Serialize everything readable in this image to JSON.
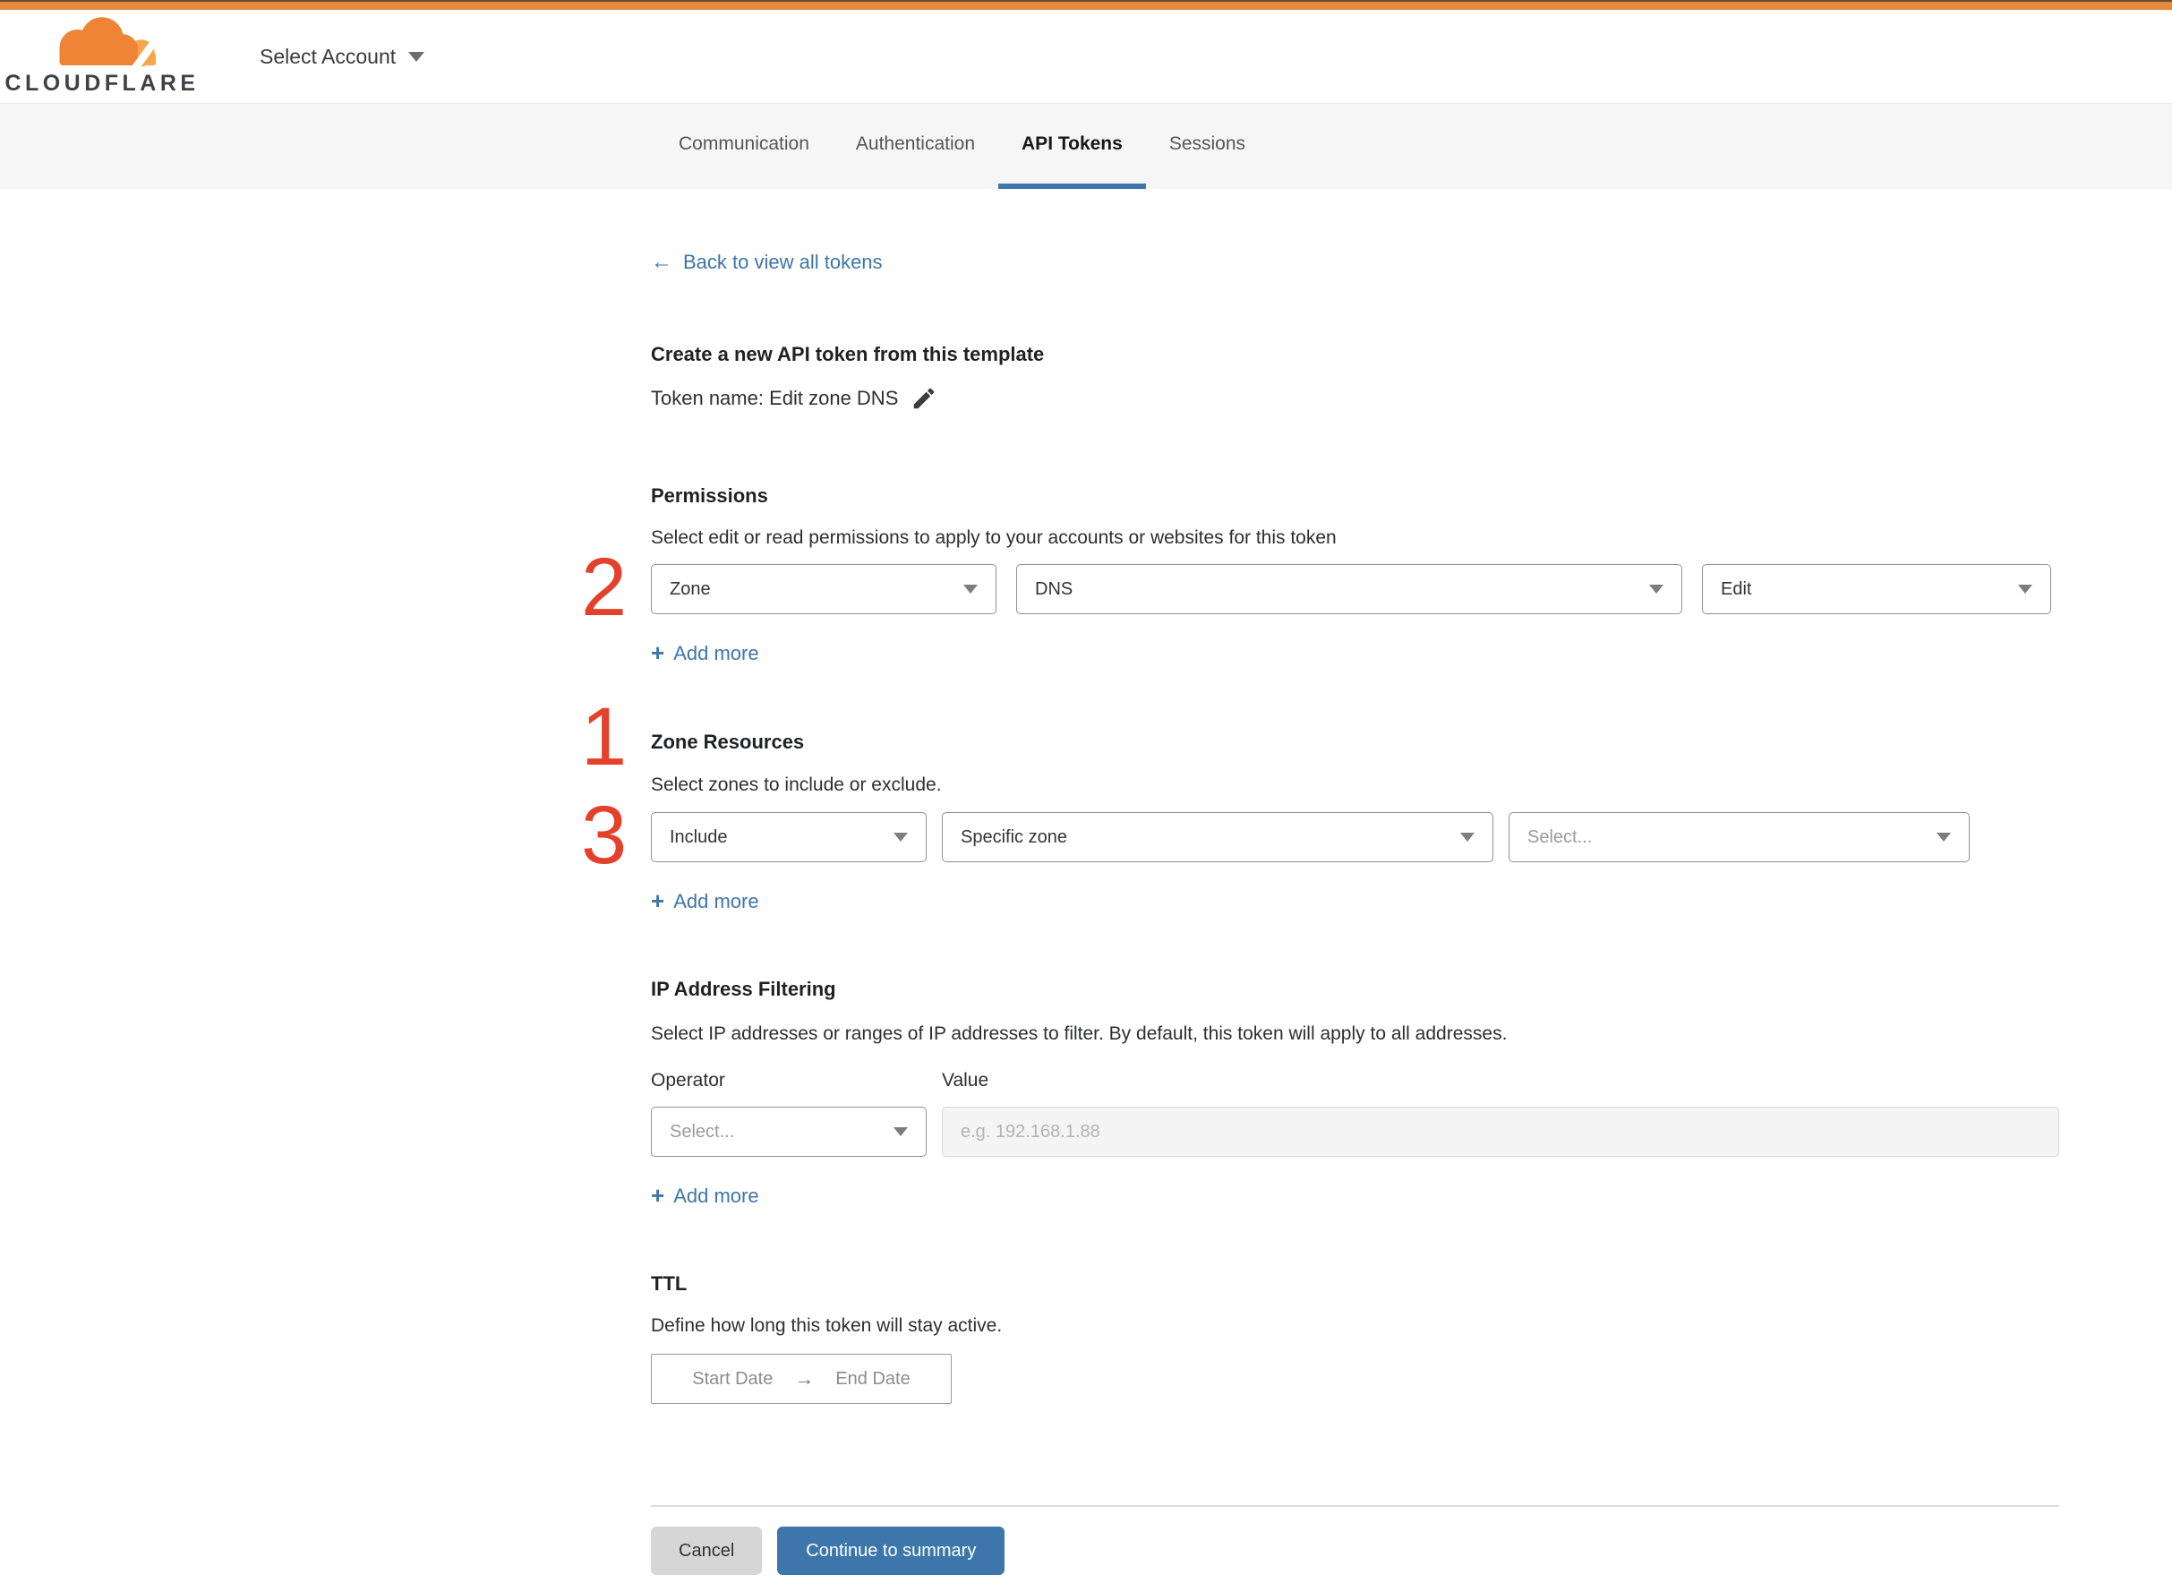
{
  "brand": {
    "logo_word": "CLOUDFLARE",
    "account_selector": "Select Account"
  },
  "tabs": [
    {
      "label": "Communication",
      "active": false
    },
    {
      "label": "Authentication",
      "active": false
    },
    {
      "label": "API Tokens",
      "active": true
    },
    {
      "label": "Sessions",
      "active": false
    }
  ],
  "back_link": {
    "arrow": "←",
    "label": "Back to view all tokens"
  },
  "steps": {
    "one": "1",
    "two": "2",
    "three": "3"
  },
  "token_section": {
    "heading": "Create a new API token from this template",
    "token_line": "Token name: Edit zone DNS"
  },
  "permissions": {
    "heading": "Permissions",
    "description": "Select edit or read permissions to apply to your accounts or websites for this token",
    "dropdowns": [
      {
        "value": "Zone"
      },
      {
        "value": "DNS"
      },
      {
        "value": "Edit"
      }
    ],
    "add_more": {
      "plus": "+",
      "label": "Add more"
    }
  },
  "zone_resources": {
    "heading": "Zone Resources",
    "description": "Select zones to include or exclude.",
    "dropdowns": [
      {
        "value": "Include"
      },
      {
        "value": "Specific zone"
      },
      {
        "value": "Select..."
      }
    ],
    "add_more": {
      "plus": "+",
      "label": "Add more"
    }
  },
  "ip_filtering": {
    "heading": "IP Address Filtering",
    "description": "Select IP addresses or ranges of IP addresses to filter. By default, this token will apply to all addresses.",
    "operator_label": "Operator",
    "value_label": "Value",
    "operator_value": "Select...",
    "value_placeholder": "e.g. 192.168.1.88",
    "add_more": {
      "plus": "+",
      "label": "Add more"
    }
  },
  "ttl": {
    "heading": "TTL",
    "description": "Define how long this token will stay active.",
    "start": "Start Date",
    "arrow": "→",
    "end": "End Date"
  },
  "footer": {
    "cancel": "Cancel",
    "continue": "Continue to summary"
  },
  "colors": {
    "accent_orange": "#e0893f",
    "link_blue": "#3e75aa",
    "step_red": "#e5402a",
    "tab_band_bg": "#f6f6f6"
  }
}
